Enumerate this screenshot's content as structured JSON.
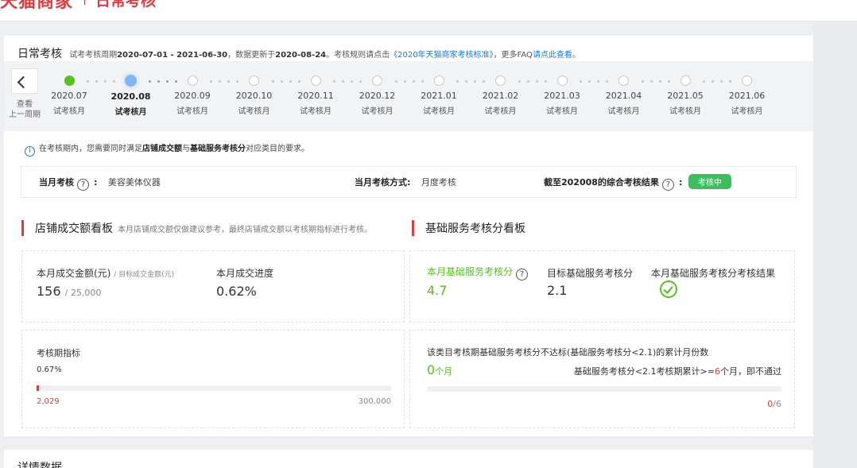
{
  "header": {
    "brand": "天猫商家",
    "subtitle": "日常考核"
  },
  "title": {
    "heading": "日常考核",
    "period_prefix": "试考考核周期",
    "period": "2020-07-01 - 2021-06-30",
    "updated_prefix": "，数据更新于",
    "updated": "2020-08-24",
    "rules_prefix": "。考核规则请点击",
    "rules_link": "《2020年天猫商家考核标准》",
    "faq_prefix": "，更多FAQ",
    "faq_link": "请点此查看",
    "end": "。"
  },
  "timeline": {
    "prev_label_1": "查看",
    "prev_label_2": "上一周期",
    "months": [
      {
        "month": "2020.07",
        "label": "试考核月",
        "state": "done"
      },
      {
        "month": "2020.08",
        "label": "试考核月",
        "state": "current"
      },
      {
        "month": "2020.09",
        "label": "试考核月",
        "state": "pending"
      },
      {
        "month": "2020.10",
        "label": "试考核月",
        "state": "pending"
      },
      {
        "month": "2020.11",
        "label": "试考核月",
        "state": "pending"
      },
      {
        "month": "2020.12",
        "label": "试考核月",
        "state": "pending"
      },
      {
        "month": "2021.01",
        "label": "试考核月",
        "state": "pending"
      },
      {
        "month": "2021.02",
        "label": "试考核月",
        "state": "pending"
      },
      {
        "month": "2021.03",
        "label": "试考核月",
        "state": "pending"
      },
      {
        "month": "2021.04",
        "label": "试考核月",
        "state": "pending"
      },
      {
        "month": "2021.05",
        "label": "试考核月",
        "state": "pending"
      },
      {
        "month": "2021.06",
        "label": "试考核月",
        "state": "pending"
      }
    ]
  },
  "notice": {
    "prefix": "在考核期内，您需要同时满足",
    "b1": "店铺成交额",
    "mid": "与",
    "b2": "基础服务考核分",
    "suffix": "对应类目的要求。"
  },
  "summary": {
    "month_label": "当月考核",
    "category": "美容美体仪器",
    "method_label": "当月考核方式:",
    "method": "月度考核",
    "result_label": "截至202008的综合考核结果",
    "status": "考核中"
  },
  "sales": {
    "title": "店铺成交额看板",
    "note": "本月店铺成交额仅做建议参考，最终店铺成交额以考核期指标进行考核。",
    "amount_label": "本月成交金额(元)",
    "target_label": "目标成交金额(元)",
    "amount": "156",
    "target": "25,000",
    "progress_label": "本月成交进度",
    "progress": "0.62%",
    "period_label": "考核期指标",
    "period_percent": "0.67%",
    "period_fraction": 0.0067,
    "period_current": "2,029",
    "period_target": "300,000"
  },
  "service": {
    "title": "基础服务考核分看板",
    "score_label": "本月基础服务考核分",
    "score": "4.7",
    "target_label": "目标基础服务考核分",
    "target": "2.1",
    "result_label": "本月基础服务考核分考核结果",
    "below_title": "该类目考核期基础服务考核分不达标(基础服务考核分<2.1)的累计月份数",
    "months": "0",
    "months_unit": "个月",
    "rule_prefix": "基础服务考核分<2.1考核期累计>=",
    "rule_num": "6",
    "rule_suffix": "个月，即不通过",
    "count": "0",
    "count_total": "/6",
    "count_fraction": 0
  },
  "details": {
    "title": "详情数据"
  },
  "colors": {
    "accent": "#e4393c",
    "green": "#52c41a",
    "link": "#1b78e0"
  }
}
